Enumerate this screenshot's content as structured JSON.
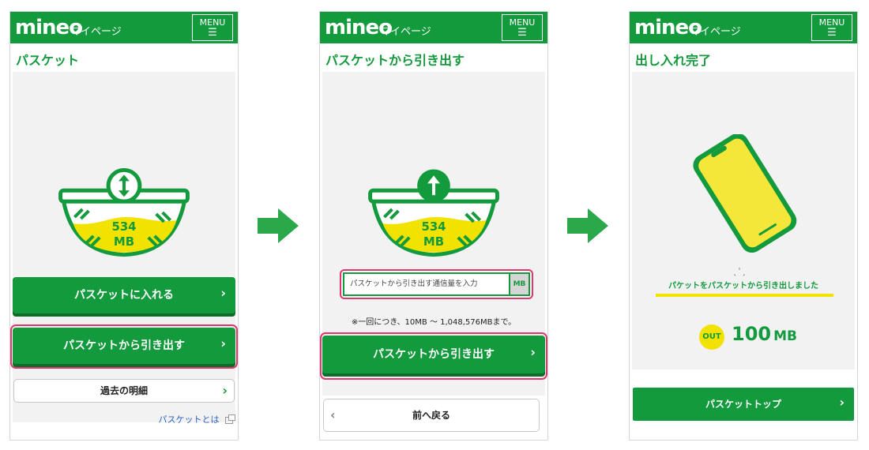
{
  "common": {
    "logo": "mineo",
    "subtitle": "マイページ",
    "menu_label": "MENU",
    "menu_icon": "hamburger-icon"
  },
  "screen1": {
    "title": "パスケット",
    "basket_amount": "534",
    "basket_unit": "MB",
    "basket_icon": "up-down-arrow-icon",
    "btn_put": "パスケットに入れる",
    "btn_withdraw": "パスケットから引き出す",
    "btn_history": "過去の明細",
    "link_about": "パスケットとは"
  },
  "screen2": {
    "title": "パスケットから引き出す",
    "basket_amount": "534",
    "basket_unit": "MB",
    "basket_icon": "up-arrow-icon",
    "input_placeholder": "パスケットから引き出す通信量を入力",
    "input_unit": "MB",
    "note": "※一回につき、10MB 〜 1,048,576MBまで。",
    "btn_withdraw": "パスケットから引き出す",
    "btn_back": "前へ戻る"
  },
  "screen3": {
    "title": "出し入れ完了",
    "message": "パケットをパスケットから引き出しました",
    "badge": "OUT",
    "amount": "100",
    "amount_unit": "MB",
    "btn_top": "パスケットトップ"
  },
  "colors": {
    "brand_green": "#129a3c",
    "highlight_pink": "#e0356f",
    "yellow": "#f1e200"
  }
}
